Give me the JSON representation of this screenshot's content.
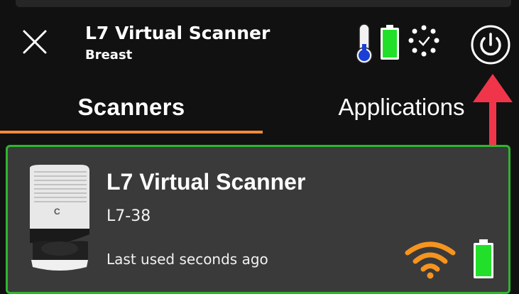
{
  "header": {
    "title": "L7 Virtual Scanner",
    "subtitle": "Breast"
  },
  "icons": {
    "close": "close-icon",
    "thermometer": "thermometer-icon",
    "battery": "battery-icon",
    "loading": "loading-spinner-icon",
    "power": "power-icon",
    "arrow": "arrow-up-icon",
    "wifi": "wifi-icon",
    "probe": "scanner-probe-image"
  },
  "status": {
    "battery_level": 1.0
  },
  "tabs": [
    {
      "label": "Scanners",
      "active": true
    },
    {
      "label": "Applications",
      "active": false
    }
  ],
  "scanner_card": {
    "name": "L7 Virtual Scanner",
    "model": "L7-38",
    "last_used": "Last used seconds ago",
    "battery_level": 1.0
  },
  "colors": {
    "background": "#111111",
    "card_bg": "#3a3a3a",
    "card_border": "#2fb52f",
    "tab_underline": "#f28a3a",
    "battery_green": "#22e02a",
    "thermometer_blue": "#1a3fd6",
    "wifi_orange": "#f5941e",
    "arrow_red": "#f0354a"
  }
}
